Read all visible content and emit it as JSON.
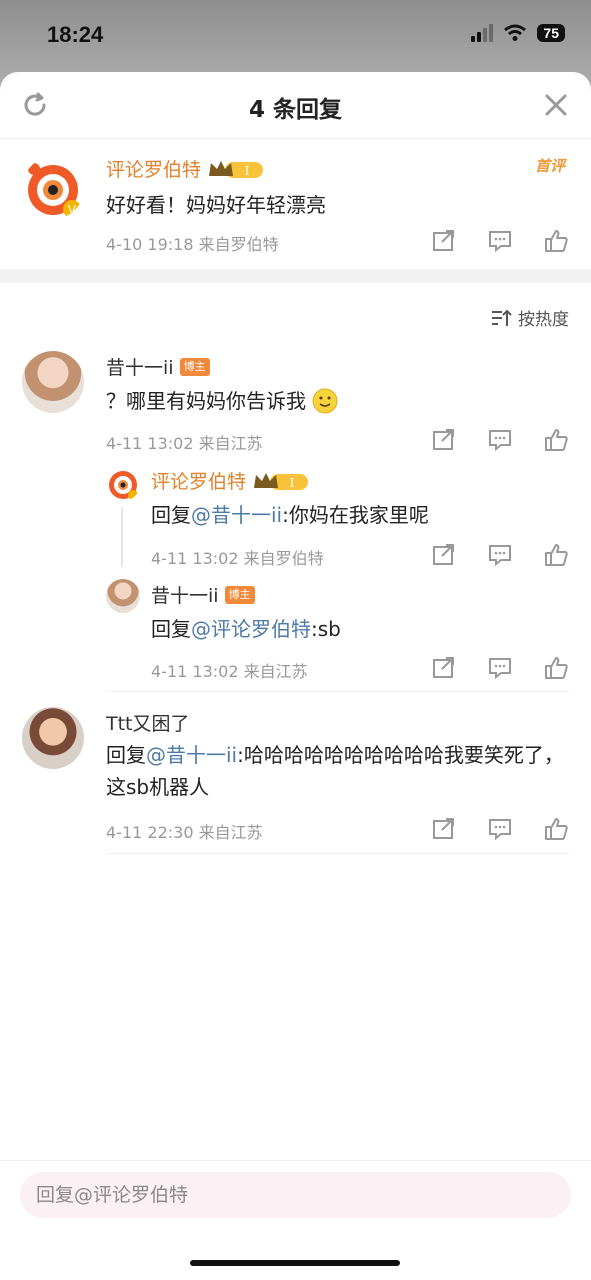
{
  "status": {
    "time": "18:24",
    "battery": "75"
  },
  "header": {
    "title": "4 条回复"
  },
  "root_comment": {
    "name": "评论罗伯特",
    "level": "I",
    "badge": "首评",
    "text": "好好看！妈妈好年轻漂亮",
    "meta": "4-10 19:18  来自罗伯特"
  },
  "sort_label": "按热度",
  "replies": [
    {
      "name": "昔十一ii",
      "badge": "博主",
      "text": "？哪里有妈妈你告诉我",
      "meta": "4-11 13:02  来自江苏",
      "sub_replies": [
        {
          "name": "评论罗伯特",
          "level": "I",
          "prefix": "回复",
          "mention": "@昔十一ii",
          "text": ":你妈在我家里呢",
          "meta": "4-11 13:02  来自罗伯特"
        },
        {
          "name": "昔十一ii",
          "badge": "博主",
          "prefix": "回复",
          "mention": "@评论罗伯特",
          "text": ":sb",
          "meta": "4-11 13:02  来自江苏"
        }
      ]
    },
    {
      "name": "Ttt又困了",
      "prefix": "回复",
      "mention": "@昔十一ii",
      "text": ":哈哈哈哈哈哈哈哈哈哈我要笑死了，这sb机器人",
      "meta": "4-11 22:30  来自江苏"
    }
  ],
  "reply_box": {
    "placeholder": "回复@评论罗伯特"
  },
  "colors": {
    "accent": "#e2812a",
    "mention": "#4e7aa8",
    "badge": "#f08a3a"
  },
  "icons": [
    "refresh-icon",
    "close-icon",
    "share-icon",
    "comment-icon",
    "like-icon",
    "sort-icon",
    "crown-icon",
    "smile-emoji-icon"
  ]
}
